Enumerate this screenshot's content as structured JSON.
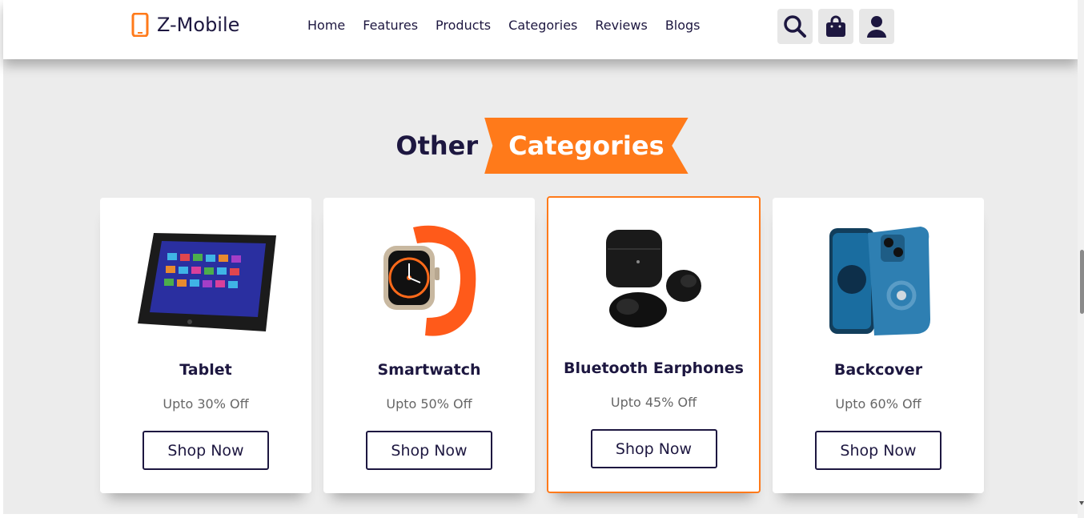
{
  "brand": {
    "name": "Z-Mobile"
  },
  "nav": {
    "items": [
      "Home",
      "Features",
      "Products",
      "Categories",
      "Reviews",
      "Blogs"
    ]
  },
  "header_icons": [
    "search-icon",
    "shopping-bag-icon",
    "user-icon"
  ],
  "section": {
    "title_dark": "Other",
    "title_highlight": "Categories"
  },
  "categories": [
    {
      "name": "Tablet",
      "offer": "Upto 30% Off",
      "button": "Shop Now"
    },
    {
      "name": "Smartwatch",
      "offer": "Upto 50% Off",
      "button": "Shop Now"
    },
    {
      "name": "Bluetooth Earphones",
      "offer": "Upto 45% Off",
      "button": "Shop Now"
    },
    {
      "name": "Backcover",
      "offer": "Upto 60% Off",
      "button": "Shop Now"
    }
  ],
  "colors": {
    "accent": "#ff7a1a",
    "dark": "#1d1740",
    "background": "#ececec"
  }
}
